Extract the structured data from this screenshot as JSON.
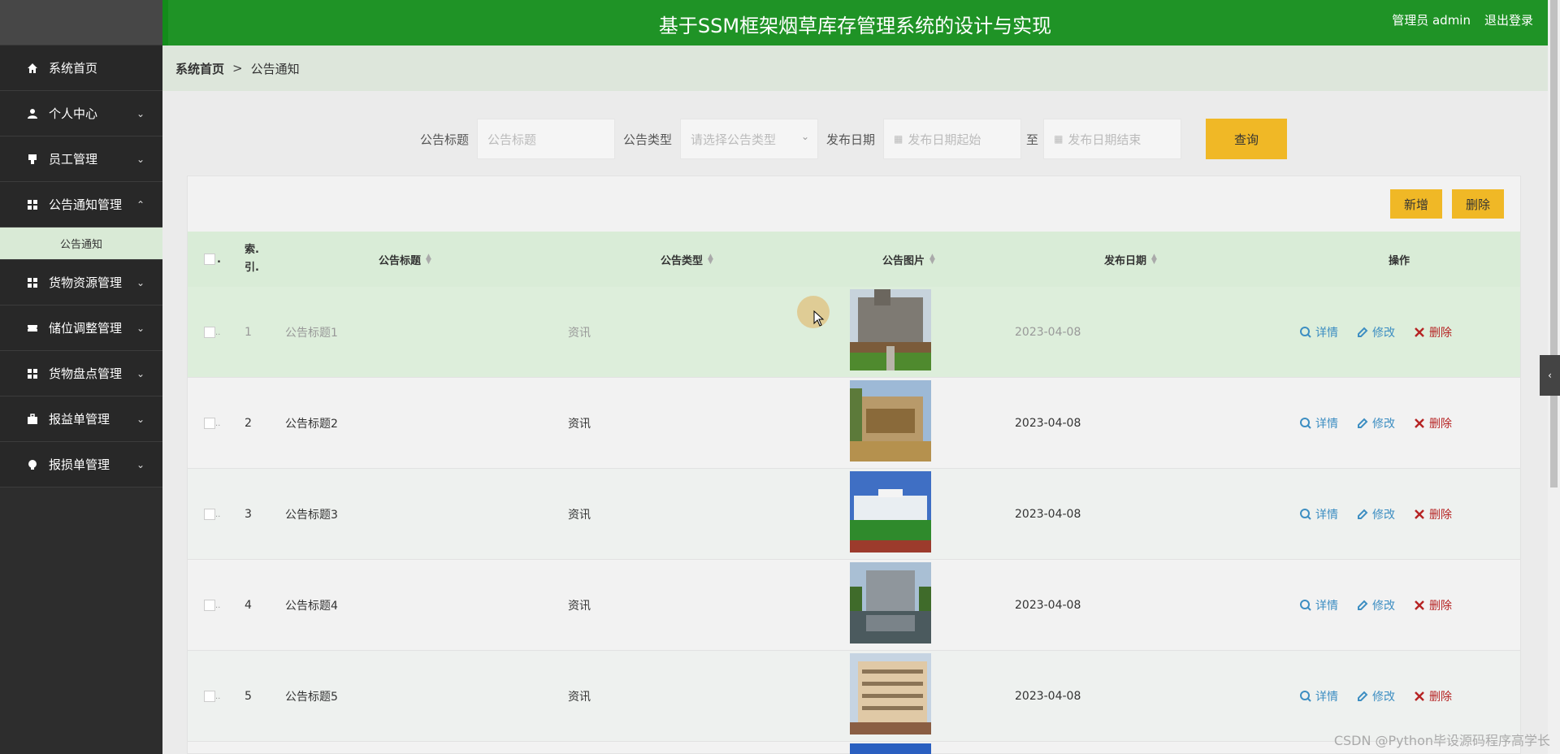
{
  "header": {
    "title": "基于SSM框架烟草库存管理系统的设计与实现",
    "user": "管理员 admin",
    "logout": "退出登录"
  },
  "sidebar": {
    "items": [
      {
        "label": "系统首页",
        "icon": "home-icon"
      },
      {
        "label": "个人中心",
        "icon": "user-icon"
      },
      {
        "label": "员工管理",
        "icon": "stamp-icon"
      },
      {
        "label": "公告通知管理",
        "icon": "grid-icon"
      },
      {
        "label": "货物资源管理",
        "icon": "grid-icon"
      },
      {
        "label": "储位调整管理",
        "icon": "ticket-icon"
      },
      {
        "label": "货物盘点管理",
        "icon": "grid-icon"
      },
      {
        "label": "报益单管理",
        "icon": "briefcase-icon"
      },
      {
        "label": "报损单管理",
        "icon": "bulb-icon"
      }
    ],
    "submenu": "公告通知"
  },
  "breadcrumb": {
    "home": "系统首页",
    "sep": ">",
    "current": "公告通知"
  },
  "search": {
    "title_label": "公告标题",
    "title_placeholder": "公告标题",
    "type_label": "公告类型",
    "type_placeholder": "请选择公告类型",
    "date_label": "发布日期",
    "date_start_placeholder": "发布日期起始",
    "date_to": "至",
    "date_end_placeholder": "发布日期结束",
    "query_btn": "查询"
  },
  "toolbar": {
    "add": "新增",
    "delete": "删除"
  },
  "table": {
    "headers": {
      "index_1": "索.",
      "index_2": "引.",
      "title": "公告标题",
      "type": "公告类型",
      "pic": "公告图片",
      "date": "发布日期",
      "ops": "操作"
    },
    "rows": [
      {
        "idx": "1",
        "title": "公告标题1",
        "type": "资讯",
        "date": "2023-04-08"
      },
      {
        "idx": "2",
        "title": "公告标题2",
        "type": "资讯",
        "date": "2023-04-08"
      },
      {
        "idx": "3",
        "title": "公告标题3",
        "type": "资讯",
        "date": "2023-04-08"
      },
      {
        "idx": "4",
        "title": "公告标题4",
        "type": "资讯",
        "date": "2023-04-08"
      },
      {
        "idx": "5",
        "title": "公告标题5",
        "type": "资讯",
        "date": "2023-04-08"
      }
    ],
    "ops": {
      "detail": "详情",
      "edit": "修改",
      "delete": "删除"
    }
  },
  "watermark": "CSDN @Python毕设源码程序高学长",
  "colors": {
    "header_green": "#1f9326",
    "accent_yellow": "#f0b826",
    "sidebar": "#2d2d2d",
    "row_highlight": "#ddeedb"
  }
}
